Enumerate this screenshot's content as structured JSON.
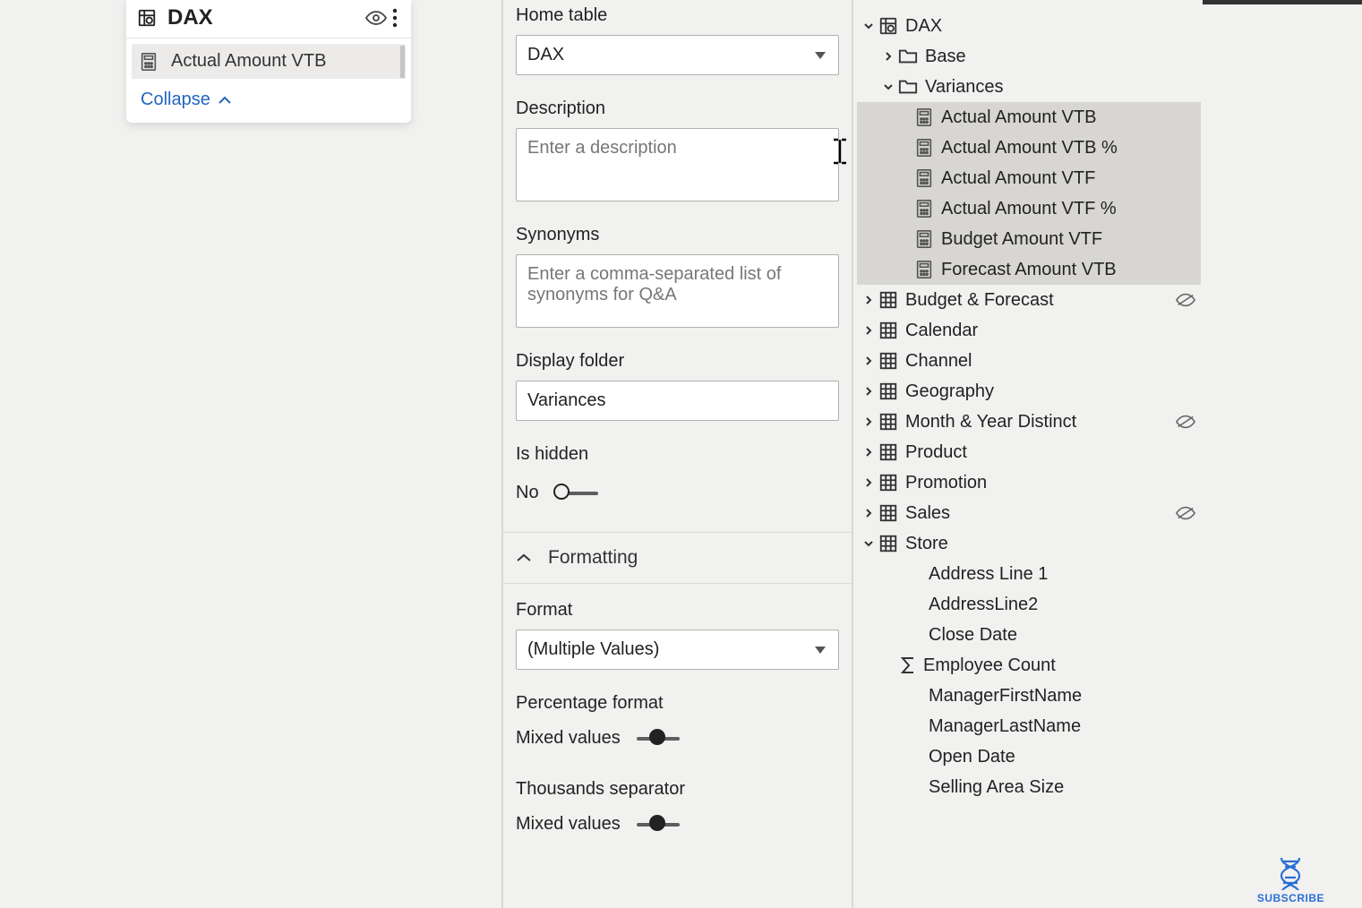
{
  "card": {
    "title": "DAX",
    "item": "Actual Amount VTB",
    "collapse": "Collapse"
  },
  "props": {
    "home_table_label": "Home table",
    "home_table_value": "DAX",
    "description_label": "Description",
    "description_placeholder": "Enter a description",
    "synonyms_label": "Synonyms",
    "synonyms_placeholder": "Enter a comma-separated list of synonyms for Q&A",
    "display_folder_label": "Display folder",
    "display_folder_value": "Variances",
    "is_hidden_label": "Is hidden",
    "is_hidden_value": "No",
    "formatting_title": "Formatting",
    "format_label": "Format",
    "format_value": "(Multiple Values)",
    "percentage_label": "Percentage format",
    "percentage_value": "Mixed values",
    "thousands_label": "Thousands separator",
    "thousands_value": "Mixed values"
  },
  "tree": {
    "dax": "DAX",
    "base": "Base",
    "variances": "Variances",
    "measures": [
      "Actual Amount VTB",
      "Actual Amount VTB %",
      "Actual Amount VTF",
      "Actual Amount VTF %",
      "Budget Amount VTF",
      "Forecast Amount VTB"
    ],
    "tables": [
      "Budget & Forecast",
      "Calendar",
      "Channel",
      "Geography",
      "Month & Year Distinct",
      "Product",
      "Promotion",
      "Sales",
      "Store"
    ],
    "store_cols": [
      "Address Line 1",
      "AddressLine2",
      "Close Date",
      "Employee Count",
      "ManagerFirstName",
      "ManagerLastName",
      "Open Date",
      "Selling Area Size"
    ]
  },
  "subscribe": "SUBSCRIBE"
}
